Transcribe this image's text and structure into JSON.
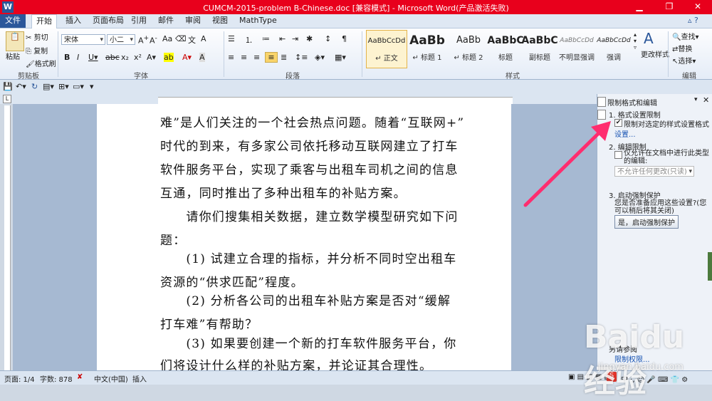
{
  "window": {
    "title": "CUMCM-2015-problem B-Chinese.doc [兼容模式] - Microsoft Word(产品激活失败)"
  },
  "tabs": [
    "文件",
    "开始",
    "插入",
    "页面布局",
    "引用",
    "邮件",
    "审阅",
    "视图",
    "MathType"
  ],
  "clipboard": {
    "paste": "粘贴",
    "cut": "剪切",
    "copy": "复制",
    "format_painter": "格式刷",
    "group": "剪贴板"
  },
  "font": {
    "name": "宋体",
    "size": "小二",
    "group": "字体"
  },
  "paragraph": {
    "group": "段落"
  },
  "styles": {
    "group": "样式",
    "items": [
      {
        "preview": "AaBbCcDd",
        "label": "↵ 正文"
      },
      {
        "preview": "AaBb",
        "label": "↵ 标题 1"
      },
      {
        "preview": "AaBb",
        "label": "↵ 标题 2"
      },
      {
        "preview": "AaBbC",
        "label": "标题"
      },
      {
        "preview": "AaBbC",
        "label": "副标题"
      },
      {
        "preview": "AaBbCcDd",
        "label": "不明显强调"
      },
      {
        "preview": "AaBbCcDd",
        "label": "强调"
      }
    ],
    "change": "更改样式"
  },
  "editing": {
    "find": "查找",
    "replace": "替换",
    "select": "选择",
    "group": "编辑"
  },
  "document": {
    "lines": [
      "难”是人们关注的一个社会热点问题。随着“互联网+”",
      "时代的到来，有多家公司依托移动互联网建立了打车",
      "软件服务平台，实现了乘客与出租车司机之间的信息",
      "互通，同时推出了多种出租车的补贴方案。",
      "　　请你们搜集相关数据，建立数学模型研究如下问",
      "题：",
      "　　(1) 试建立合理的指标，并分析不同时空出租车",
      "资源的“供求匹配”程度。",
      "　　(2) 分析各公司的出租车补贴方案是否对“缓解",
      "打车难”有帮助？",
      "　　(3) 如果要创建一个新的打车软件服务平台，你",
      "们将设计什么样的补贴方案，并论证其合理性。"
    ]
  },
  "pane": {
    "title": "限制格式和编辑",
    "section1": "1. 格式设置限制",
    "check1": "限制对选定的样式设置格式",
    "settings_link": "设置...",
    "section2": "2. 编辑限制",
    "check2": "仅允许在文档中进行此类型的编辑:",
    "edit_select": "不允许任何更改(只读)",
    "section3": "3. 启动强制保护",
    "prompt": "您是否准备应用这些设置?(您可以稍后将其关闭)",
    "start_button": "是，启动强制保护",
    "also_see": "另请参阅",
    "restrict_link": "限制权限..."
  },
  "status": {
    "page": "页面: 1/4",
    "words": "字数: 878",
    "lang": "中文(中国)",
    "mode": "插入"
  },
  "watermark": {
    "main": "Baidu经验",
    "sub": "jingyan.baidu.com"
  },
  "colors": {
    "titlebar": "#e8001c",
    "file_tab": "#2b579a",
    "arrow": "#ff2d6f"
  }
}
